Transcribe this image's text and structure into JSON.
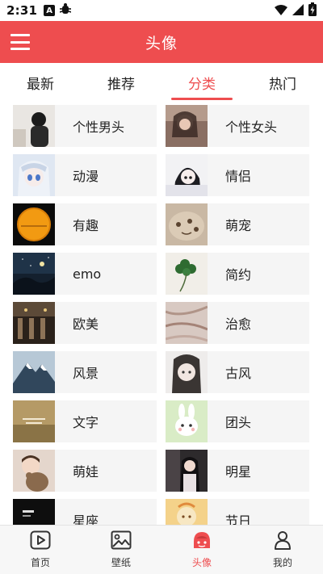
{
  "status_bar": {
    "time": "2:31",
    "icons": [
      "A-badge-icon",
      "bug-icon"
    ],
    "right_icons": [
      "wifi-icon",
      "signal-icon",
      "battery-charging-icon"
    ]
  },
  "header": {
    "title": "头像",
    "background": "#ee4d4f"
  },
  "tabs": [
    {
      "label": "最新",
      "active": false
    },
    {
      "label": "推荐",
      "active": false
    },
    {
      "label": "分类",
      "active": true
    },
    {
      "label": "热门",
      "active": false
    }
  ],
  "categories": [
    {
      "label": "个性男头",
      "thumb": "boy-avatar"
    },
    {
      "label": "个性女头",
      "thumb": "girl-avatar"
    },
    {
      "label": "动漫",
      "thumb": "anime-white-hair"
    },
    {
      "label": "情侣",
      "thumb": "anime-couple"
    },
    {
      "label": "有趣",
      "thumb": "orange-moon"
    },
    {
      "label": "萌宠",
      "thumb": "pet-closeup"
    },
    {
      "label": "emo",
      "thumb": "night-sky"
    },
    {
      "label": "简约",
      "thumb": "clover-leaf"
    },
    {
      "label": "欧美",
      "thumb": "dark-architecture"
    },
    {
      "label": "治愈",
      "thumb": "marble-texture"
    },
    {
      "label": "风景",
      "thumb": "snow-mountain"
    },
    {
      "label": "古风",
      "thumb": "ancient-style-portrait"
    },
    {
      "label": "文字",
      "thumb": "blurry-text-scene"
    },
    {
      "label": "团头",
      "thumb": "cute-rabbit"
    },
    {
      "label": "萌娃",
      "thumb": "baby-with-bear"
    },
    {
      "label": "明星",
      "thumb": "celebrity-portrait"
    },
    {
      "label": "星座",
      "thumb": "dark-text-card"
    },
    {
      "label": "节日",
      "thumb": "holiday-illustration"
    }
  ],
  "bottom_nav": [
    {
      "label": "首页",
      "icon": "play-video-icon",
      "active": false
    },
    {
      "label": "壁纸",
      "icon": "image-icon",
      "active": false
    },
    {
      "label": "头像",
      "icon": "avatar-face-icon",
      "active": true
    },
    {
      "label": "我的",
      "icon": "user-profile-icon",
      "active": false
    }
  ]
}
